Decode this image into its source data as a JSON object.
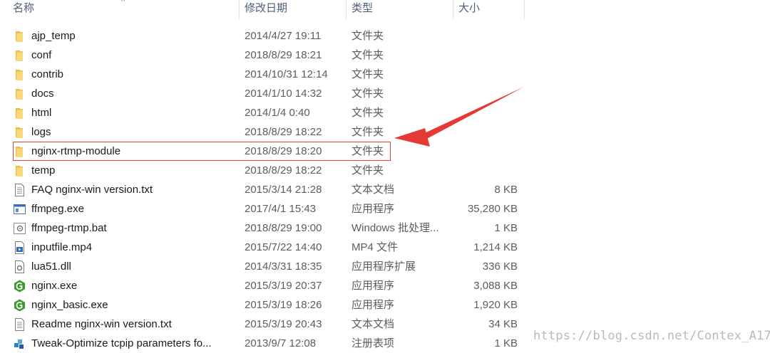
{
  "header": {
    "name": "名称",
    "date": "修改日期",
    "type": "类型",
    "size": "大小"
  },
  "files": [
    {
      "name": "ajp_temp",
      "date": "2014/4/27 19:11",
      "type": "文件夹",
      "size": "",
      "icon": "folder-icon"
    },
    {
      "name": "conf",
      "date": "2018/8/29 18:21",
      "type": "文件夹",
      "size": "",
      "icon": "folder-icon"
    },
    {
      "name": "contrib",
      "date": "2014/10/31 12:14",
      "type": "文件夹",
      "size": "",
      "icon": "folder-icon"
    },
    {
      "name": "docs",
      "date": "2014/1/10 14:32",
      "type": "文件夹",
      "size": "",
      "icon": "folder-icon"
    },
    {
      "name": "html",
      "date": "2014/1/4 0:40",
      "type": "文件夹",
      "size": "",
      "icon": "folder-icon"
    },
    {
      "name": "logs",
      "date": "2018/8/29 18:22",
      "type": "文件夹",
      "size": "",
      "icon": "folder-icon"
    },
    {
      "name": "nginx-rtmp-module",
      "date": "2018/8/29 18:20",
      "type": "文件夹",
      "size": "",
      "icon": "folder-icon"
    },
    {
      "name": "temp",
      "date": "2018/8/29 18:22",
      "type": "文件夹",
      "size": "",
      "icon": "folder-icon"
    },
    {
      "name": "FAQ nginx-win version.txt",
      "date": "2015/3/14 21:28",
      "type": "文本文档",
      "size": "8 KB",
      "icon": "text-file-icon"
    },
    {
      "name": "ffmpeg.exe",
      "date": "2017/4/1 15:43",
      "type": "应用程序",
      "size": "35,280 KB",
      "icon": "exe-icon"
    },
    {
      "name": "ffmpeg-rtmp.bat",
      "date": "2018/8/29 19:00",
      "type": "Windows 批处理...",
      "size": "1 KB",
      "icon": "batch-file-icon"
    },
    {
      "name": "inputfile.mp4",
      "date": "2015/7/22 14:40",
      "type": "MP4 文件",
      "size": "1,214 KB",
      "icon": "video-file-icon"
    },
    {
      "name": "lua51.dll",
      "date": "2014/3/31 18:35",
      "type": "应用程序扩展",
      "size": "336 KB",
      "icon": "dll-file-icon"
    },
    {
      "name": "nginx.exe",
      "date": "2015/3/19 20:37",
      "type": "应用程序",
      "size": "3,088 KB",
      "icon": "nginx-icon"
    },
    {
      "name": "nginx_basic.exe",
      "date": "2015/3/19 18:26",
      "type": "应用程序",
      "size": "1,920 KB",
      "icon": "nginx-icon"
    },
    {
      "name": "Readme nginx-win version.txt",
      "date": "2015/3/19 20:43",
      "type": "文本文档",
      "size": "34 KB",
      "icon": "text-file-icon"
    },
    {
      "name": "Tweak-Optimize tcpip parameters fo...",
      "date": "2013/9/7 12:08",
      "type": "注册表项",
      "size": "1 KB",
      "icon": "registry-file-icon"
    }
  ],
  "watermark": "https://blog.csdn.net/Contex_A17",
  "colors": {
    "highlight": "#e04040",
    "folder": "#f2c55c",
    "nginx": "#3a9a2e"
  }
}
